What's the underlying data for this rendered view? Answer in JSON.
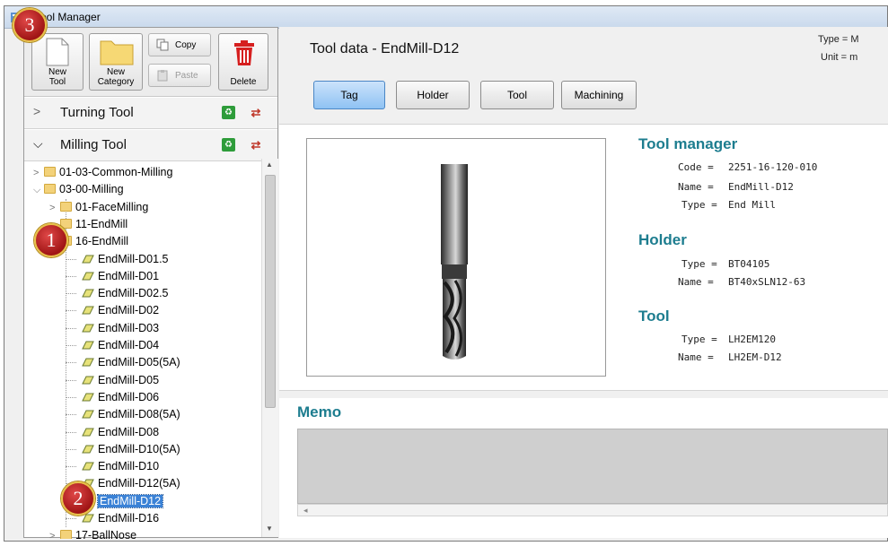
{
  "window": {
    "title": "Tool Manager"
  },
  "toolbar": {
    "new_tool": "New\nTool",
    "new_tool_l1": "New",
    "new_tool_l2": "Tool",
    "new_category_l1": "New",
    "new_category_l2": "Category",
    "copy": "Copy",
    "paste": "Paste",
    "delete": "Delete"
  },
  "sections": {
    "turning": "Turning Tool",
    "milling": "Milling Tool"
  },
  "tree": [
    {
      "label": "01-03-Common-Milling",
      "type": "folder",
      "level": 0,
      "chev": ">"
    },
    {
      "label": "03-00-Milling",
      "type": "folder",
      "level": 0,
      "chev": "v"
    },
    {
      "label": "01-FaceMilling",
      "type": "folder",
      "level": 1,
      "chev": ">"
    },
    {
      "label": "11-EndMill",
      "type": "folder",
      "level": 1,
      "chev": ""
    },
    {
      "label": "16-EndMill",
      "type": "folder",
      "level": 1,
      "chev": ""
    },
    {
      "label": "EndMill-D01.5",
      "type": "tool",
      "level": 2
    },
    {
      "label": "EndMill-D01",
      "type": "tool",
      "level": 2
    },
    {
      "label": "EndMill-D02.5",
      "type": "tool",
      "level": 2
    },
    {
      "label": "EndMill-D02",
      "type": "tool",
      "level": 2
    },
    {
      "label": "EndMill-D03",
      "type": "tool",
      "level": 2
    },
    {
      "label": "EndMill-D04",
      "type": "tool",
      "level": 2
    },
    {
      "label": "EndMill-D05(5A)",
      "type": "tool",
      "level": 2
    },
    {
      "label": "EndMill-D05",
      "type": "tool",
      "level": 2
    },
    {
      "label": "EndMill-D06",
      "type": "tool",
      "level": 2
    },
    {
      "label": "EndMill-D08(5A)",
      "type": "tool",
      "level": 2
    },
    {
      "label": "EndMill-D08",
      "type": "tool",
      "level": 2
    },
    {
      "label": "EndMill-D10(5A)",
      "type": "tool",
      "level": 2
    },
    {
      "label": "EndMill-D10",
      "type": "tool",
      "level": 2
    },
    {
      "label": "EndMill-D12(5A)",
      "type": "tool",
      "level": 2
    },
    {
      "label": "EndMill-D12",
      "type": "tool",
      "level": 2,
      "selected": true
    },
    {
      "label": "EndMill-D16",
      "type": "tool",
      "level": 2
    },
    {
      "label": "17-BallNose",
      "type": "folder",
      "level": 1,
      "chev": ">"
    }
  ],
  "right": {
    "title": "Tool data - EndMill-D12",
    "type_info": "Type = M",
    "unit_info": "Unit = m",
    "tabs": [
      "Tag",
      "Holder",
      "Tool",
      "Machining"
    ],
    "active_tab": "Tag",
    "tool_manager": {
      "heading": "Tool manager",
      "code_key": "Code =",
      "code": "2251-16-120-010",
      "name_key": "Name =",
      "name": "EndMill-D12",
      "type_key": "Type =",
      "type": "End Mill"
    },
    "holder": {
      "heading": "Holder",
      "type_key": "Type =",
      "type": "BT04105",
      "name_key": "Name =",
      "name": "BT40xSLN12-63"
    },
    "tool": {
      "heading": "Tool",
      "type_key": "Type =",
      "type": "LH2EM120",
      "name_key": "Name =",
      "name": "LH2EM-D12"
    },
    "memo": {
      "heading": "Memo"
    }
  },
  "badges": {
    "one": "1",
    "two": "2",
    "three": "3"
  }
}
